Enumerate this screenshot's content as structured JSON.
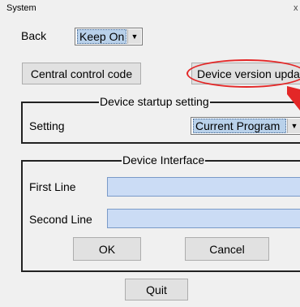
{
  "window": {
    "title": "System",
    "close_glyph": "x"
  },
  "back": {
    "label": "Back",
    "selected": "Keep On"
  },
  "buttons": {
    "central_control": "Central control code",
    "device_version_update": "Device version update",
    "ok": "OK",
    "cancel": "Cancel",
    "quit": "Quit"
  },
  "startup": {
    "legend": "Device startup setting",
    "setting_label": "Setting",
    "selected": "Current Program"
  },
  "interface": {
    "legend": "Device Interface",
    "first_line_label": "First Line",
    "first_line_value": "",
    "second_line_label": "Second Line",
    "second_line_value": ""
  },
  "icons": {
    "dropdown": "triangle-down-icon",
    "annotation_arrow": "red-arrow-icon"
  },
  "colors": {
    "highlight": "#e32727",
    "field": "#cbdcf5",
    "selection": "#b9d1ea"
  }
}
